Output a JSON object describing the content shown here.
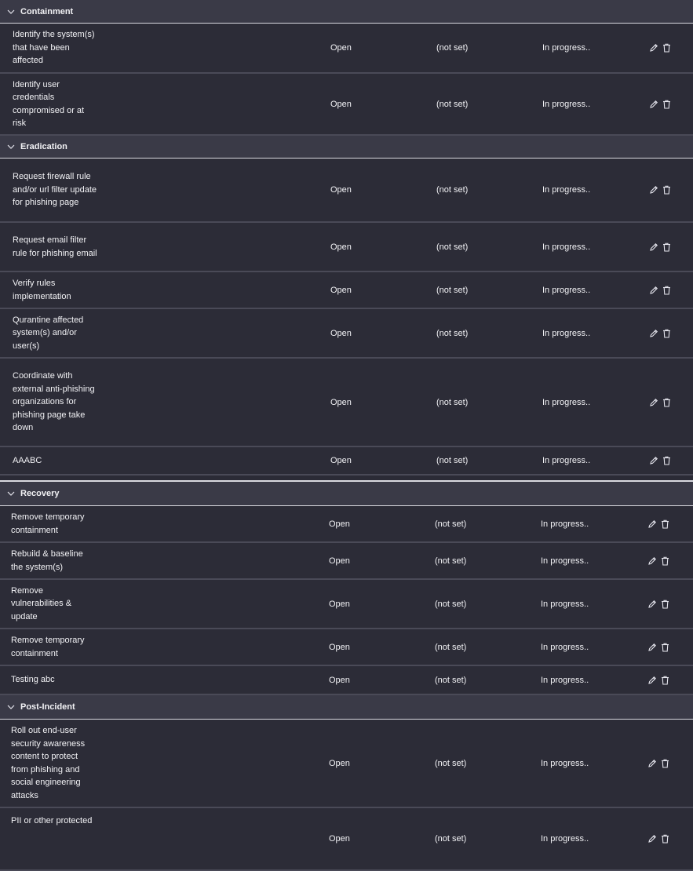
{
  "colors": {
    "background": "#2b2b36",
    "header_bg": "#3a3a47",
    "row_divider": "#4a4a57",
    "text": "#f2f2f5"
  },
  "icons": {
    "collapse": "chevron-down-icon",
    "edit": "pencil-icon",
    "delete": "trash-icon"
  },
  "sections": [
    {
      "title": "Containment",
      "tasks": [
        {
          "name": "Identify the system(s) that have been affected",
          "status": "Open",
          "owner": "(not set)",
          "progress": "In progress.."
        },
        {
          "name": "Identify user credentials compromised or at risk",
          "status": "Open",
          "owner": "(not set)",
          "progress": "In progress.."
        }
      ]
    },
    {
      "title": "Eradication",
      "tasks": [
        {
          "name": "Request firewall rule and/or url filter update for phishing page",
          "status": "Open",
          "owner": "(not set)",
          "progress": "In progress.."
        },
        {
          "name": "Request email filter rule for phishing email",
          "status": "Open",
          "owner": "(not set)",
          "progress": "In progress.."
        },
        {
          "name": "Verify rules implementation",
          "status": "Open",
          "owner": "(not set)",
          "progress": "In progress.."
        },
        {
          "name": "Qurantine affected system(s) and/or user(s)",
          "status": "Open",
          "owner": "(not set)",
          "progress": "In progress.."
        },
        {
          "name": "Coordinate with external anti-phishing organizations for phishing page take down",
          "status": "Open",
          "owner": "(not set)",
          "progress": "In progress.."
        },
        {
          "name": "AAABC",
          "status": "Open",
          "owner": "(not set)",
          "progress": "In progress.."
        }
      ]
    },
    {
      "title": "Recovery",
      "tasks": [
        {
          "name": "Remove temporary containment",
          "status": "Open",
          "owner": "(not set)",
          "progress": "In progress.."
        },
        {
          "name": "Rebuild & baseline the system(s)",
          "status": "Open",
          "owner": "(not set)",
          "progress": "In progress.."
        },
        {
          "name": "Remove vulnerabilities & update",
          "status": "Open",
          "owner": "(not set)",
          "progress": "In progress.."
        },
        {
          "name": "Remove temporary containment",
          "status": "Open",
          "owner": "(not set)",
          "progress": "In progress.."
        },
        {
          "name": "Testing abc",
          "status": "Open",
          "owner": "(not set)",
          "progress": "In progress.."
        }
      ]
    },
    {
      "title": "Post-Incident",
      "tasks": [
        {
          "name": "Roll out end-user security awareness content to protect from phishing and social engineering attacks",
          "status": "Open",
          "owner": "(not set)",
          "progress": "In progress.."
        },
        {
          "name": "PII or other protected",
          "status": "Open",
          "owner": "(not set)",
          "progress": "In progress.."
        }
      ]
    }
  ]
}
